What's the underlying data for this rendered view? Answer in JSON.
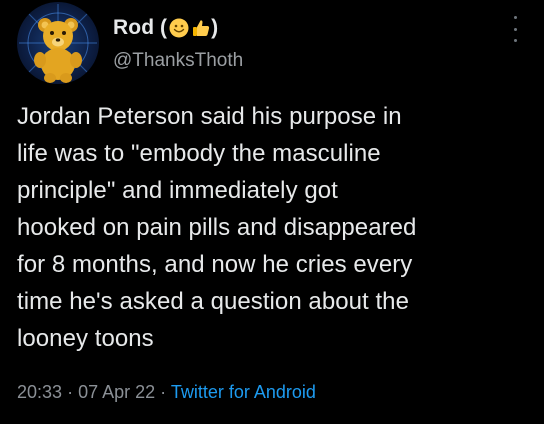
{
  "tweet": {
    "display_name": "Rod (",
    "display_name_close": ")",
    "name_emojis": [
      "smiling-face-emoji",
      "thumbs-up-emoji"
    ],
    "handle": "@ThanksThoth",
    "text": "Jordan Peterson said his purpose in\nlife was to \"embody the masculine\nprinciple\" and immediately got\nhooked on pain pills and disappeared\nfor 8 months, and now he cries every\ntime he's asked a question about the\nlooney toons",
    "time": "20:33",
    "separator": "·",
    "date": "07 Apr 22",
    "source": "Twitter for Android"
  },
  "colors": {
    "background": "#000000",
    "text": "#e7e9ea",
    "secondary_text": "#8b9096",
    "link": "#1d9bf0"
  },
  "icons": {
    "more": "more-vertical-icon",
    "avatar": "teddy-bear-avatar"
  }
}
